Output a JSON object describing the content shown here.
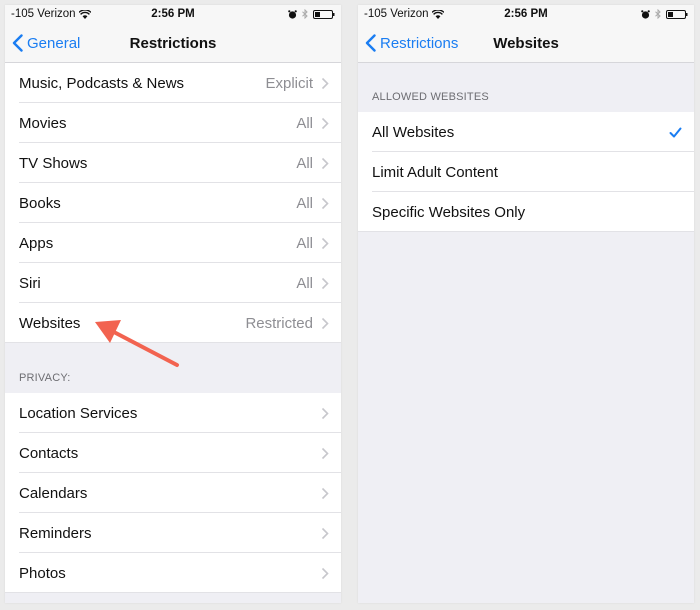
{
  "status_bar": {
    "carrier": "-105 Verizon",
    "time": "2:56 PM",
    "icons": [
      "wifi-icon",
      "alarm-icon",
      "bluetooth-icon",
      "battery-icon"
    ]
  },
  "left_screen": {
    "nav": {
      "back_label": "General",
      "title": "Restrictions"
    },
    "content_rows": [
      {
        "label": "Music, Podcasts & News",
        "value": "Explicit"
      },
      {
        "label": "Movies",
        "value": "All"
      },
      {
        "label": "TV Shows",
        "value": "All"
      },
      {
        "label": "Books",
        "value": "All"
      },
      {
        "label": "Apps",
        "value": "All"
      },
      {
        "label": "Siri",
        "value": "All"
      },
      {
        "label": "Websites",
        "value": "Restricted"
      }
    ],
    "privacy_header": "PRIVACY:",
    "privacy_rows": [
      {
        "label": "Location Services"
      },
      {
        "label": "Contacts"
      },
      {
        "label": "Calendars"
      },
      {
        "label": "Reminders"
      },
      {
        "label": "Photos"
      }
    ],
    "annotation": {
      "type": "arrow",
      "points_to": "Websites",
      "color": "#f26350"
    }
  },
  "right_screen": {
    "nav": {
      "back_label": "Restrictions",
      "title": "Websites"
    },
    "section_header": "ALLOWED WEBSITES",
    "options": [
      {
        "label": "All Websites",
        "selected": true
      },
      {
        "label": "Limit Adult Content",
        "selected": false
      },
      {
        "label": "Specific Websites Only",
        "selected": false
      }
    ]
  },
  "colors": {
    "accent": "#1a7df2",
    "annotation_arrow": "#f26350",
    "grouped_background": "#efeff4"
  }
}
